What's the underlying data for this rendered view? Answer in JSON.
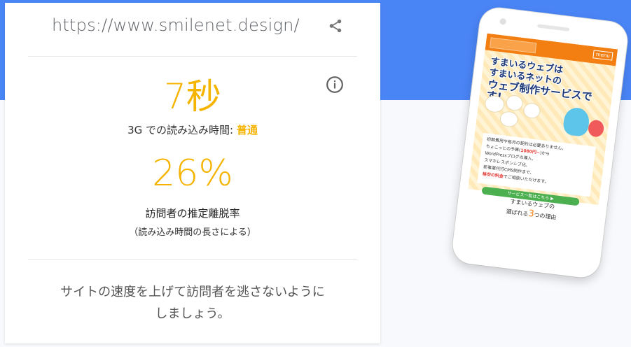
{
  "report": {
    "url": "https://www.smilenet.design/",
    "load_time": "7秒",
    "load_time_label": "3G での読み込み時間: ",
    "load_status": "普通",
    "bounce_rate": "26%",
    "bounce_label": "訪問者の推定離脱率",
    "bounce_sublabel": "（読み込み時間の長さによる）",
    "cta_line1": "サイトの速度を上げて訪問者を逃さないように",
    "cta_line2": "しましょう。"
  },
  "icons": {
    "share": "share-icon",
    "info": "info-icon"
  },
  "phone_preview": {
    "menu_label": "menu",
    "hero_line1": "すまいるウェブは",
    "hero_line2": "すまいるネットの",
    "hero_line3": "ウェブ制作サービスです!",
    "info_line1": "初期費用や毎月の契約は必要ありません。",
    "info_line2": "ちょこっとの予算(",
    "info_price": "1080円~",
    "info_line2b": ")から",
    "info_line3": "WordPressブログの導入、",
    "info_line4": "スマホレスポンシブ化、",
    "info_line5": "新事業代行CMS制作まで、",
    "info_line6a": "",
    "info_line6_red": "格安の料金",
    "info_line6b": "でご相談いただけます。",
    "button_label": "サービス一覧はこちら ▶",
    "footer_line1": "すまいるウェブの",
    "footer_line2a": "選ばれる",
    "footer_num": "3",
    "footer_line2b": "つの理由"
  },
  "colors": {
    "accent_yellow": "#f5b400",
    "top_band_blue": "#4a85f6",
    "site_orange": "#f37f12"
  }
}
